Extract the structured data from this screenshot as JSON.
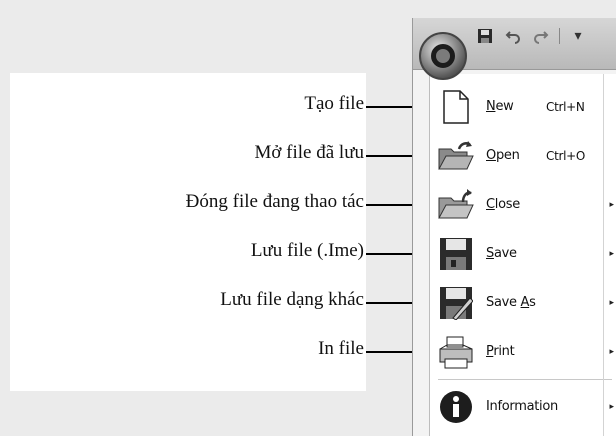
{
  "callouts": [
    {
      "label": "Tạo file"
    },
    {
      "label": "Mở file đã lưu"
    },
    {
      "label": "Đóng file đang thao tác"
    },
    {
      "label": "Lưu file (.Ime)"
    },
    {
      "label": "Lưu file dạng khác"
    },
    {
      "label": "In file"
    }
  ],
  "office_button": {
    "icon": "office-orb-icon"
  },
  "quick_access": {
    "save_icon": "save-icon",
    "undo_icon": "undo-icon",
    "redo_icon": "redo-icon",
    "dropdown": "▾"
  },
  "menu": {
    "items": [
      {
        "key": "new",
        "text_u": "N",
        "text_rest": "ew",
        "shortcut": "Ctrl+N",
        "icon": "new-document-icon"
      },
      {
        "key": "open",
        "text_u": "O",
        "text_rest": "pen",
        "shortcut": "Ctrl+O",
        "icon": "open-folder-icon"
      },
      {
        "key": "close",
        "text_u": "C",
        "text_rest": "lose",
        "submenu": "▸",
        "icon": "close-folder-icon"
      },
      {
        "key": "save",
        "text_u": "S",
        "text_rest": "ave",
        "submenu": "▸",
        "icon": "save-disk-icon"
      },
      {
        "key": "saveas",
        "text_pre": "Save ",
        "text_u": "A",
        "text_rest": "s",
        "submenu": "▸",
        "icon": "save-as-icon"
      },
      {
        "key": "print",
        "text_u": "P",
        "text_rest": "rint",
        "submenu": "▸",
        "icon": "printer-icon"
      },
      {
        "key": "information",
        "text_u": "",
        "text_rest": "Information",
        "submenu": "▸",
        "icon": "information-icon"
      }
    ]
  }
}
